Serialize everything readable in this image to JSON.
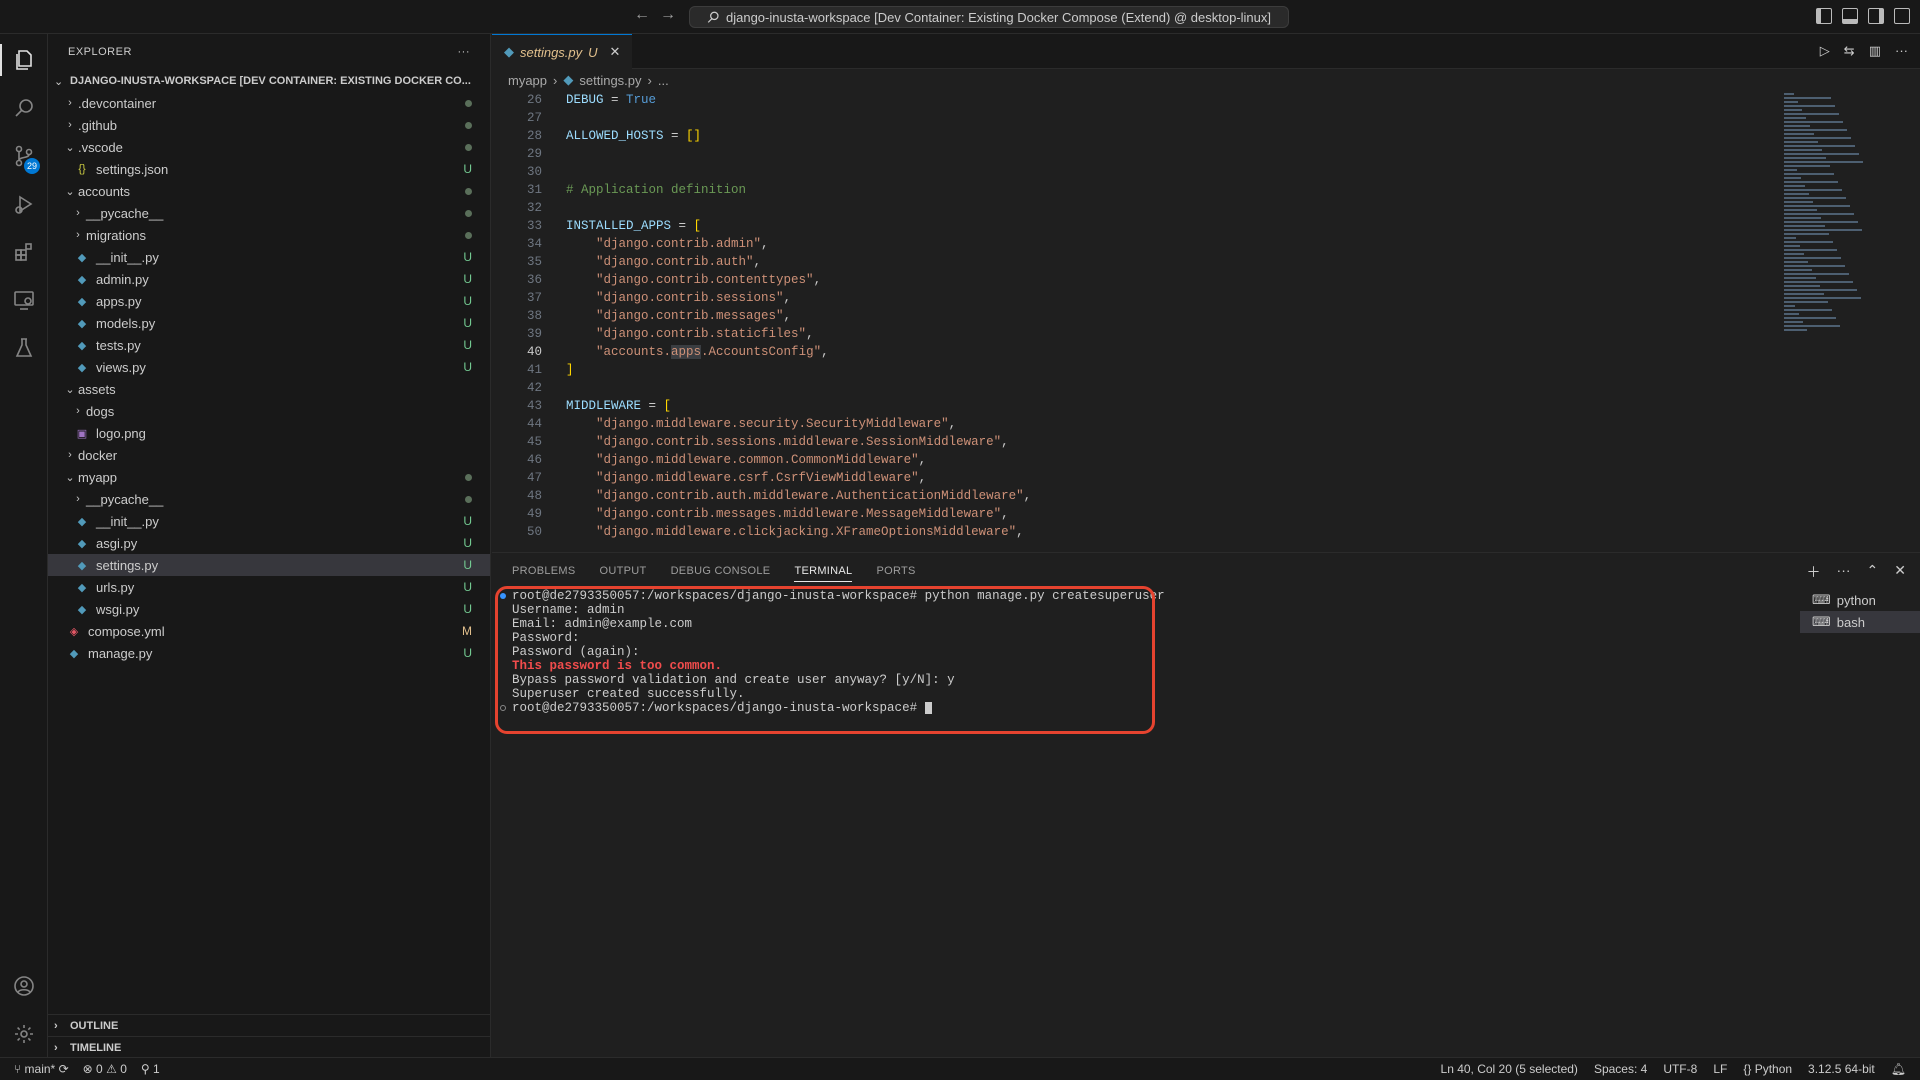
{
  "titlebar": {
    "back": "←",
    "forward": "→",
    "command_center": "django-inusta-workspace [Dev Container: Existing Docker Compose (Extend) @ desktop-linux]"
  },
  "activity": {
    "scm_badge": "29"
  },
  "sidebar": {
    "header": "EXPLORER",
    "more": "···",
    "workspace_title": "DJANGO-INUSTA-WORKSPACE [DEV CONTAINER: EXISTING DOCKER CO...",
    "items": [
      {
        "label": ".devcontainer",
        "type": "folder",
        "indent": 1,
        "open": false,
        "status": "dot"
      },
      {
        "label": ".github",
        "type": "folder",
        "indent": 1,
        "open": false,
        "status": "dot"
      },
      {
        "label": ".vscode",
        "type": "folder",
        "indent": 1,
        "open": true,
        "status": "dot"
      },
      {
        "label": "settings.json",
        "type": "json",
        "indent": 2,
        "status": "U"
      },
      {
        "label": "accounts",
        "type": "folder",
        "indent": 1,
        "open": true,
        "status": "dot"
      },
      {
        "label": "__pycache__",
        "type": "folder",
        "indent": 2,
        "open": false,
        "status": "dot"
      },
      {
        "label": "migrations",
        "type": "folder",
        "indent": 2,
        "open": false,
        "status": "dot"
      },
      {
        "label": "__init__.py",
        "type": "py",
        "indent": 2,
        "status": "U"
      },
      {
        "label": "admin.py",
        "type": "py",
        "indent": 2,
        "status": "U"
      },
      {
        "label": "apps.py",
        "type": "py",
        "indent": 2,
        "status": "U"
      },
      {
        "label": "models.py",
        "type": "py",
        "indent": 2,
        "status": "U"
      },
      {
        "label": "tests.py",
        "type": "py",
        "indent": 2,
        "status": "U"
      },
      {
        "label": "views.py",
        "type": "py",
        "indent": 2,
        "status": "U"
      },
      {
        "label": "assets",
        "type": "folder",
        "indent": 1,
        "open": true,
        "status": ""
      },
      {
        "label": "dogs",
        "type": "folder",
        "indent": 2,
        "open": false,
        "status": ""
      },
      {
        "label": "logo.png",
        "type": "img",
        "indent": 2,
        "status": ""
      },
      {
        "label": "docker",
        "type": "folder",
        "indent": 1,
        "open": false,
        "status": ""
      },
      {
        "label": "myapp",
        "type": "folder",
        "indent": 1,
        "open": true,
        "status": "dot"
      },
      {
        "label": "__pycache__",
        "type": "folder",
        "indent": 2,
        "open": false,
        "status": "dot"
      },
      {
        "label": "__init__.py",
        "type": "py",
        "indent": 2,
        "status": "U"
      },
      {
        "label": "asgi.py",
        "type": "py",
        "indent": 2,
        "status": "U"
      },
      {
        "label": "settings.py",
        "type": "py",
        "indent": 2,
        "status": "U",
        "selected": true
      },
      {
        "label": "urls.py",
        "type": "py",
        "indent": 2,
        "status": "U"
      },
      {
        "label": "wsgi.py",
        "type": "py",
        "indent": 2,
        "status": "U"
      },
      {
        "label": "compose.yml",
        "type": "yml",
        "indent": 1,
        "status": "M"
      },
      {
        "label": "manage.py",
        "type": "py",
        "indent": 1,
        "status": "U"
      }
    ],
    "outline": "OUTLINE",
    "timeline": "TIMELINE"
  },
  "editor": {
    "tab": {
      "label": "settings.py",
      "status": "U"
    },
    "breadcrumb": [
      "myapp",
      "settings.py",
      "..."
    ],
    "current_line": 40,
    "lines": [
      {
        "n": 26,
        "text": "DEBUG = True"
      },
      {
        "n": 27,
        "text": ""
      },
      {
        "n": 28,
        "text": "ALLOWED_HOSTS = []"
      },
      {
        "n": 29,
        "text": ""
      },
      {
        "n": 30,
        "text": ""
      },
      {
        "n": 31,
        "text": "# Application definition"
      },
      {
        "n": 32,
        "text": ""
      },
      {
        "n": 33,
        "text": "INSTALLED_APPS = ["
      },
      {
        "n": 34,
        "text": "    \"django.contrib.admin\","
      },
      {
        "n": 35,
        "text": "    \"django.contrib.auth\","
      },
      {
        "n": 36,
        "text": "    \"django.contrib.contenttypes\","
      },
      {
        "n": 37,
        "text": "    \"django.contrib.sessions\","
      },
      {
        "n": 38,
        "text": "    \"django.contrib.messages\","
      },
      {
        "n": 39,
        "text": "    \"django.contrib.staticfiles\","
      },
      {
        "n": 40,
        "text": "    \"accounts.apps.AccountsConfig\","
      },
      {
        "n": 41,
        "text": "]"
      },
      {
        "n": 42,
        "text": ""
      },
      {
        "n": 43,
        "text": "MIDDLEWARE = ["
      },
      {
        "n": 44,
        "text": "    \"django.middleware.security.SecurityMiddleware\","
      },
      {
        "n": 45,
        "text": "    \"django.contrib.sessions.middleware.SessionMiddleware\","
      },
      {
        "n": 46,
        "text": "    \"django.middleware.common.CommonMiddleware\","
      },
      {
        "n": 47,
        "text": "    \"django.middleware.csrf.CsrfViewMiddleware\","
      },
      {
        "n": 48,
        "text": "    \"django.contrib.auth.middleware.AuthenticationMiddleware\","
      },
      {
        "n": 49,
        "text": "    \"django.contrib.messages.middleware.MessageMiddleware\","
      },
      {
        "n": 50,
        "text": "    \"django.middleware.clickjacking.XFrameOptionsMiddleware\","
      }
    ]
  },
  "panel": {
    "tabs": [
      "PROBLEMS",
      "OUTPUT",
      "DEBUG CONSOLE",
      "TERMINAL",
      "PORTS"
    ],
    "active_tab": "TERMINAL",
    "terminal_lines": [
      {
        "text": "root@de2793350057:/workspaces/django-inusta-workspace# python manage.py createsuperuser",
        "mark": "blue"
      },
      {
        "text": "Username: admin"
      },
      {
        "text": "Email: admin@example.com"
      },
      {
        "text": "Password:"
      },
      {
        "text": "Password (again):"
      },
      {
        "text": "This password is too common.",
        "error": true
      },
      {
        "text": "Bypass password validation and create user anyway? [y/N]: y"
      },
      {
        "text": "Superuser created successfully."
      },
      {
        "text": "root@de2793350057:/workspaces/django-inusta-workspace# ",
        "mark": "hollow",
        "cursor": true
      }
    ],
    "terminals": [
      {
        "label": "python",
        "active": false
      },
      {
        "label": "bash",
        "active": true
      }
    ]
  },
  "statusbar": {
    "branch": "main*",
    "errors": "0",
    "warnings": "0",
    "ports": "1",
    "position": "Ln 40, Col 20 (5 selected)",
    "spaces": "Spaces: 4",
    "encoding": "UTF-8",
    "eol": "LF",
    "language": "Python",
    "interpreter": "3.12.5 64-bit"
  },
  "colors": {
    "accent": "#0078d4",
    "highlight_box": "#e5432f",
    "untracked": "#73c991",
    "modified": "#e2c08d"
  }
}
